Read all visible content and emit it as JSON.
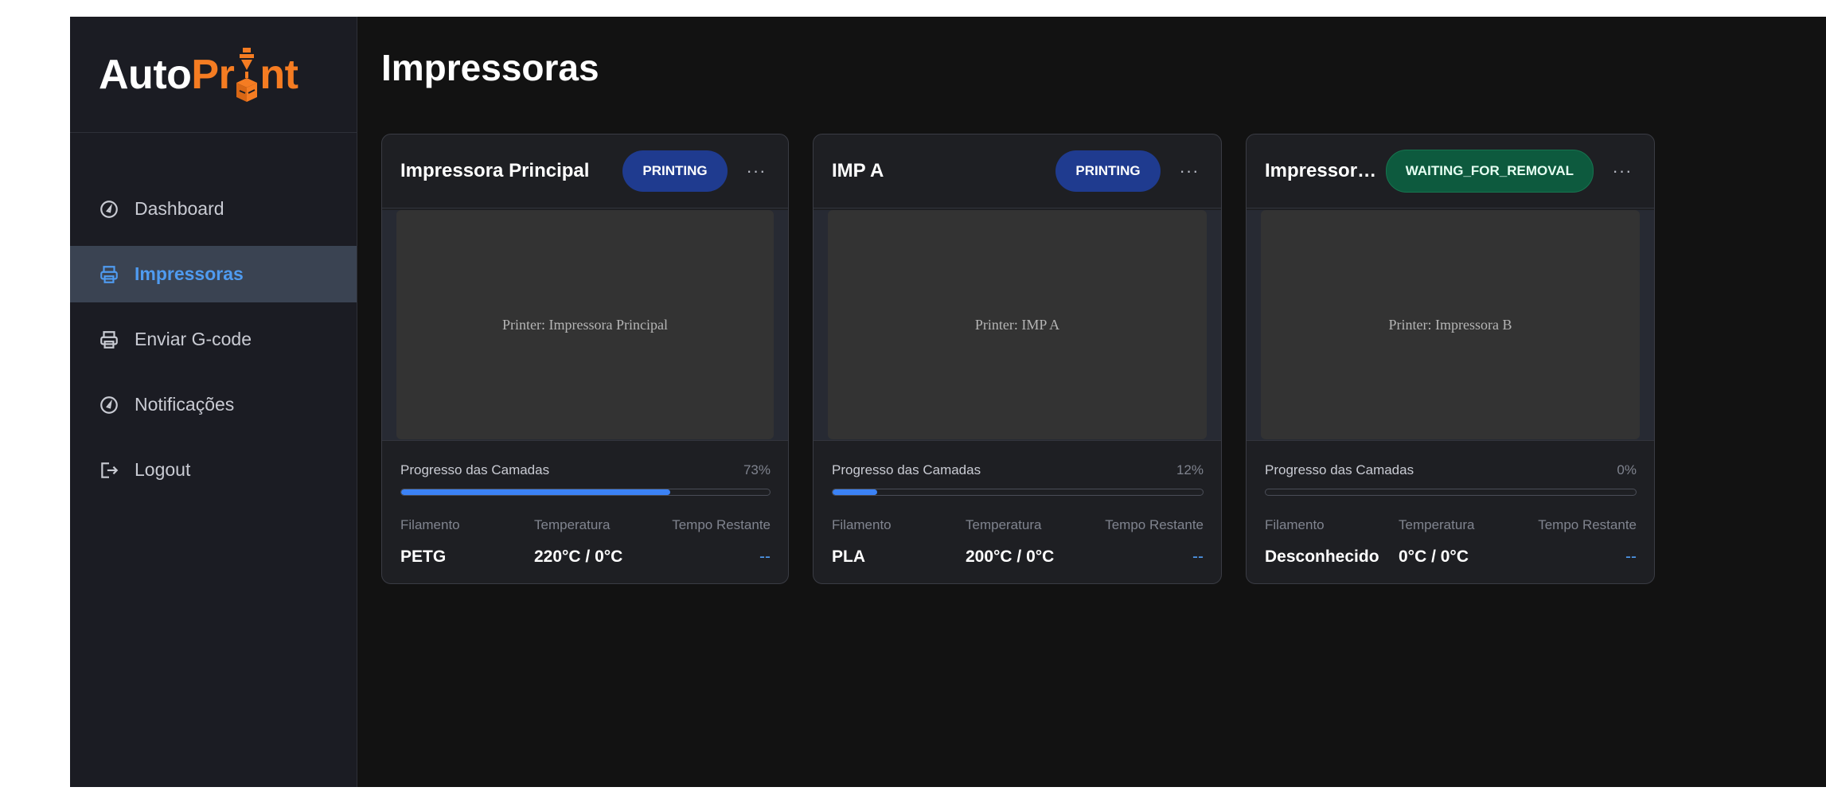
{
  "brand": {
    "part1": "Auto",
    "part2_start": "Pr",
    "part2_end": "nt",
    "accent": "#f57c22"
  },
  "sidebar": {
    "items": [
      {
        "label": "Dashboard",
        "icon": "gauge-icon",
        "active": false
      },
      {
        "label": "Impressoras",
        "icon": "printer-icon",
        "active": true
      },
      {
        "label": "Enviar G-code",
        "icon": "printer-icon",
        "active": false
      },
      {
        "label": "Notificações",
        "icon": "gauge-icon",
        "active": false
      },
      {
        "label": "Logout",
        "icon": "logout-icon",
        "active": false
      }
    ]
  },
  "page": {
    "title": "Impressoras"
  },
  "labels": {
    "progress": "Progresso das Camadas",
    "filament": "Filamento",
    "temperature": "Temperatura",
    "remaining": "Tempo Restante",
    "more": "···"
  },
  "printers": [
    {
      "name": "Impressora Principal",
      "status": "PRINTING",
      "status_color": "#1f3b8f",
      "preview": "Printer: Impressora Principal",
      "progress_text": "73%",
      "progress": 0.73,
      "filament": "PETG",
      "temperature": "220°C / 0°C",
      "remaining": "--"
    },
    {
      "name": "IMP A",
      "status": "PRINTING",
      "status_color": "#1f3b8f",
      "preview": "Printer: IMP A",
      "progress_text": "12%",
      "progress": 0.12,
      "filament": "PLA",
      "temperature": "200°C / 0°C",
      "remaining": "--"
    },
    {
      "name": "Impressora B",
      "status": "WAITING_FOR_REMOVAL",
      "status_color": "#0d5a3e",
      "preview": "Printer: Impressora B",
      "progress_text": "0%",
      "progress": 0,
      "filament": "Desconhecido",
      "temperature": "0°C / 0°C",
      "remaining": "--"
    }
  ]
}
